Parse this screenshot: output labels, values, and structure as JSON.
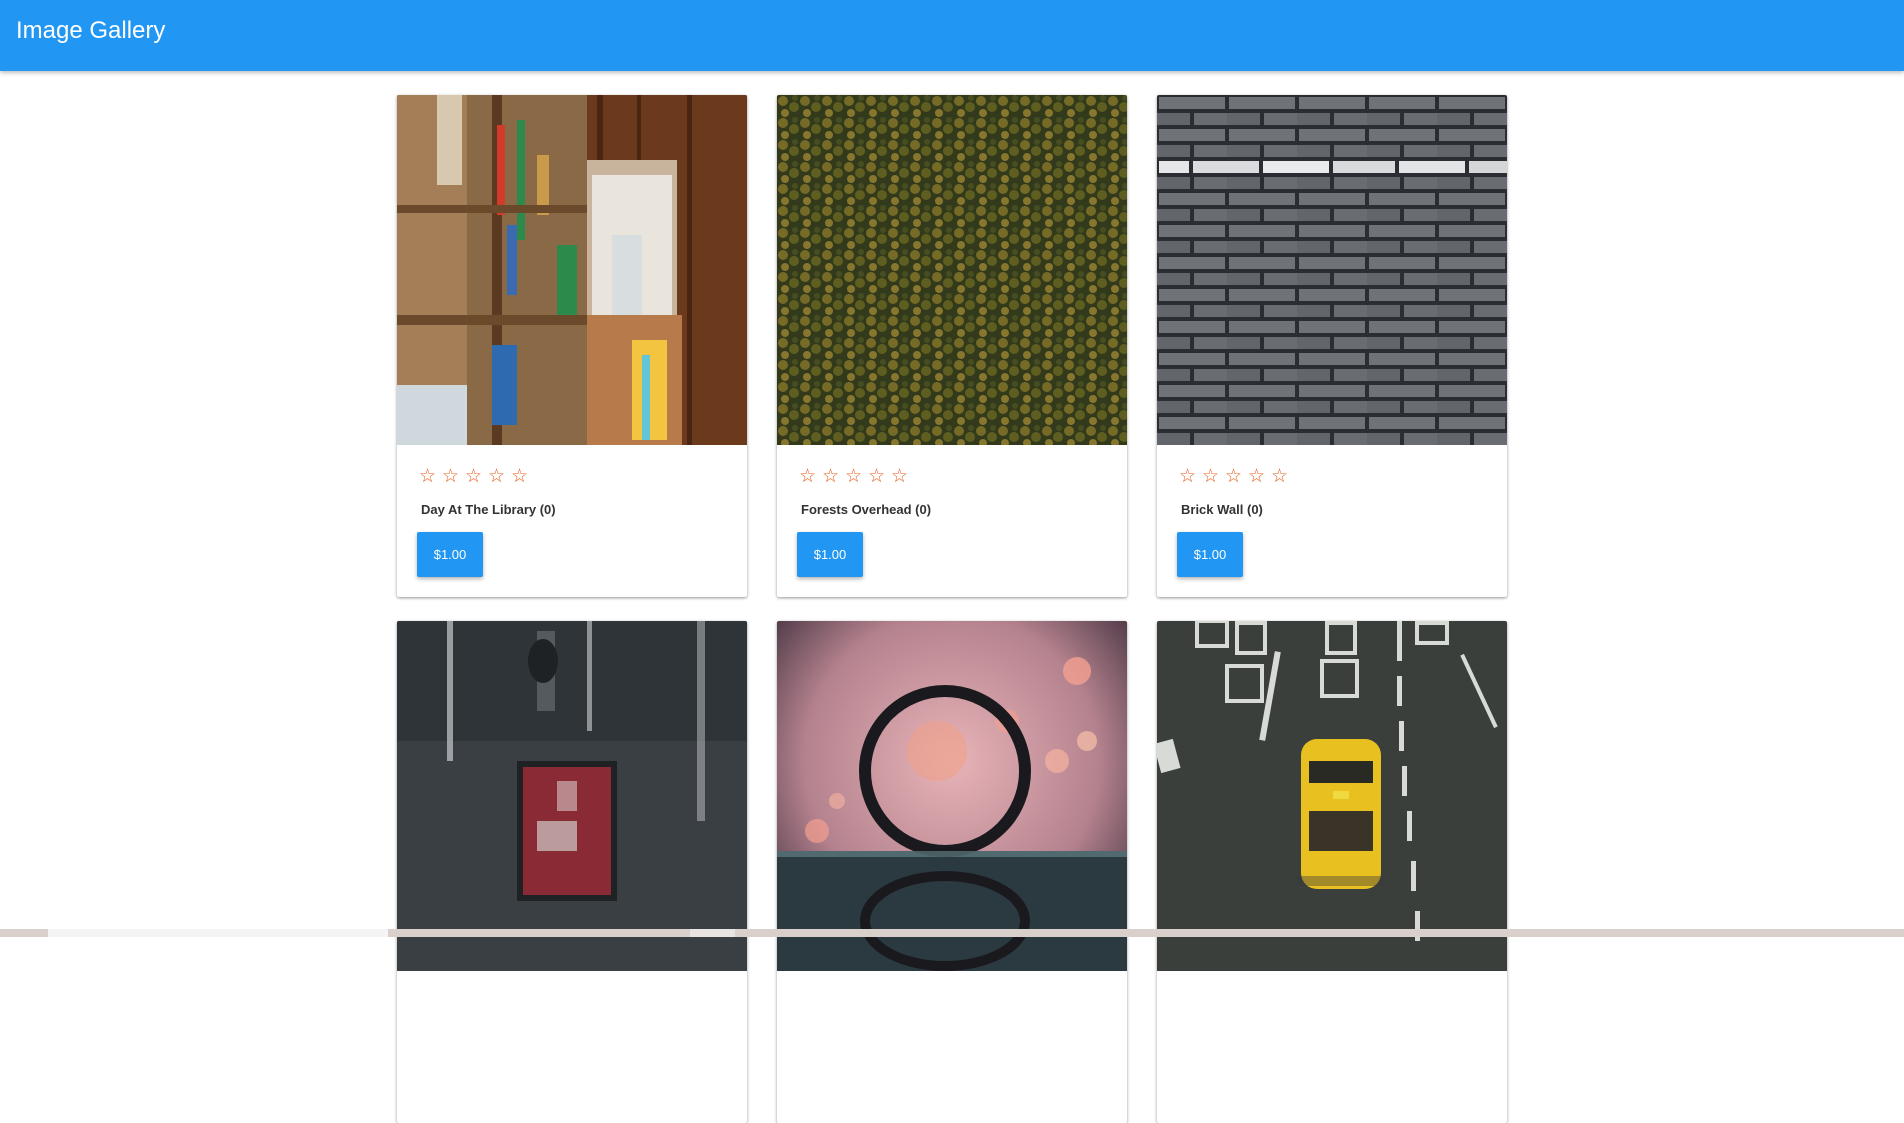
{
  "app": {
    "title": "Image Gallery"
  },
  "cards": [
    {
      "title": "Day At The Library (0)",
      "price": "$1.00",
      "rating": 0,
      "image": "library-photo"
    },
    {
      "title": "Forests Overhead (0)",
      "price": "$1.00",
      "rating": 0,
      "image": "forest-aerial-photo"
    },
    {
      "title": "Brick Wall (0)",
      "price": "$1.00",
      "rating": 0,
      "image": "brick-wall-photo"
    },
    {
      "title": "",
      "price": "",
      "rating": 0,
      "image": "concrete-wall-door-photo"
    },
    {
      "title": "",
      "price": "",
      "rating": 0,
      "image": "lens-ring-bokeh-photo"
    },
    {
      "title": "",
      "price": "",
      "rating": 0,
      "image": "yellow-taxi-road-photo"
    }
  ],
  "star_glyph": "☆",
  "colors": {
    "accent": "#2196f3",
    "star": "#e8601c"
  }
}
